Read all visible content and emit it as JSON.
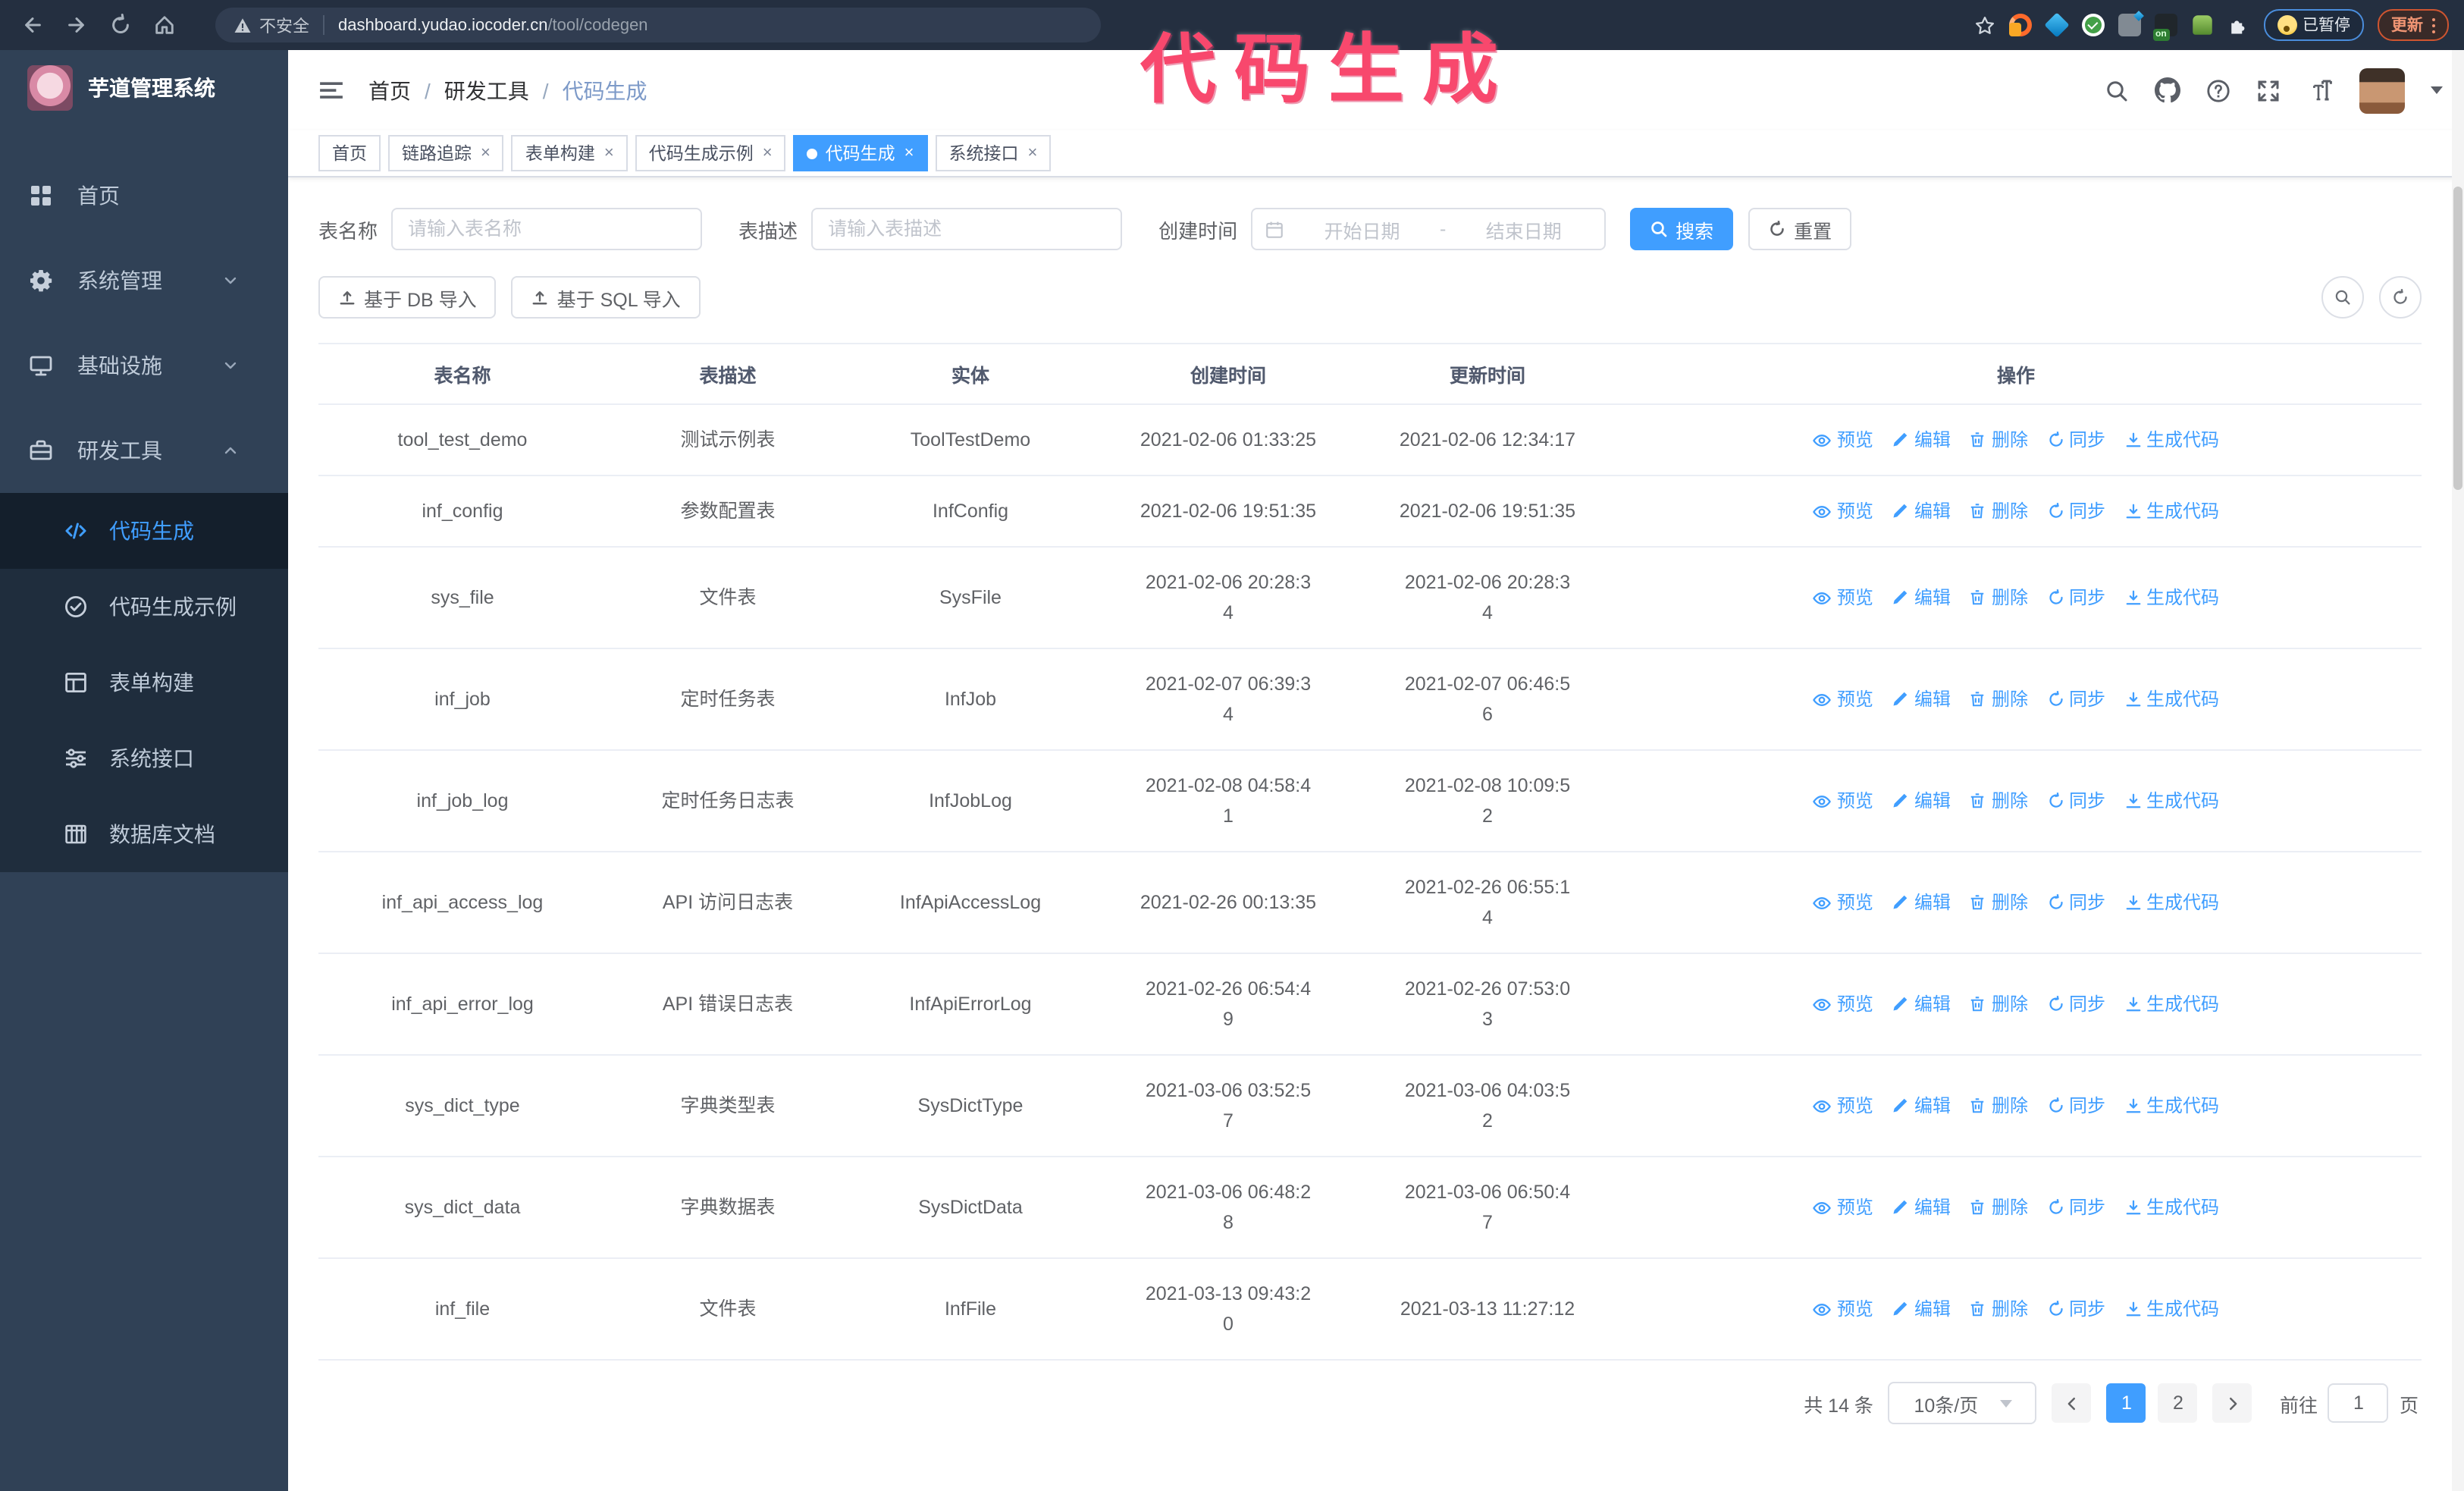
{
  "browser": {
    "insecure_label": "不安全",
    "url_host": "dashboard.yudao.iocoder.cn",
    "url_path": "/tool/codegen",
    "ext_on_label": "on",
    "paused_badge": "已暂停",
    "update_button": "更新",
    "nav_icons": [
      "back-icon",
      "forward-icon",
      "reload-icon",
      "home-icon"
    ],
    "extension_icons": [
      "ext-orange-icon",
      "ext-gem-icon",
      "ext-check-icon",
      "ext-grid-icon",
      "ext-on-icon",
      "ext-green-icon",
      "extensions-puzzle-icon"
    ]
  },
  "annotation": {
    "text": "代码生成",
    "color": "#f8486d"
  },
  "sidebar": {
    "title": "芋道管理系统",
    "items": [
      {
        "label": "首页",
        "icon": "dashboard",
        "chevron": null
      },
      {
        "label": "系统管理",
        "icon": "gear",
        "chevron": "down"
      },
      {
        "label": "基础设施",
        "icon": "monitor",
        "chevron": "down"
      },
      {
        "label": "研发工具",
        "icon": "toolbox",
        "chevron": "up"
      }
    ],
    "sub_items": [
      {
        "label": "代码生成",
        "icon": "code",
        "active": true
      },
      {
        "label": "代码生成示例",
        "icon": "check-circle",
        "active": false
      },
      {
        "label": "表单构建",
        "icon": "form",
        "active": false
      },
      {
        "label": "系统接口",
        "icon": "sliders",
        "active": false
      },
      {
        "label": "数据库文档",
        "icon": "tablecols",
        "active": false
      }
    ]
  },
  "breadcrumb": {
    "items": [
      "首页",
      "研发工具",
      "代码生成"
    ],
    "separator": "/"
  },
  "header_icons": [
    "search",
    "github",
    "question",
    "fullscreen",
    "fontsize"
  ],
  "tabs": [
    {
      "label": "首页",
      "closable": false,
      "active": false
    },
    {
      "label": "链路追踪",
      "closable": true,
      "active": false
    },
    {
      "label": "表单构建",
      "closable": true,
      "active": false
    },
    {
      "label": "代码生成示例",
      "closable": true,
      "active": false
    },
    {
      "label": "代码生成",
      "closable": true,
      "active": true
    },
    {
      "label": "系统接口",
      "closable": true,
      "active": false
    }
  ],
  "search_form": {
    "table_name_label": "表名称",
    "table_name_placeholder": "请输入表名称",
    "table_desc_label": "表描述",
    "table_desc_placeholder": "请输入表描述",
    "create_time_label": "创建时间",
    "start_placeholder": "开始日期",
    "range_separator": "-",
    "end_placeholder": "结束日期",
    "search_label": "搜索",
    "reset_label": "重置"
  },
  "toolbar": {
    "import_db_label": "基于 DB 导入",
    "import_sql_label": "基于 SQL 导入"
  },
  "table": {
    "columns": [
      "表名称",
      "表描述",
      "实体",
      "创建时间",
      "更新时间",
      "操作"
    ],
    "actions": [
      {
        "key": "preview",
        "label": "预览",
        "icon": "eye"
      },
      {
        "key": "edit",
        "label": "编辑",
        "icon": "pen"
      },
      {
        "key": "delete",
        "label": "删除",
        "icon": "trash"
      },
      {
        "key": "sync",
        "label": "同步",
        "icon": "sync"
      },
      {
        "key": "generate",
        "label": "生成代码",
        "icon": "download"
      }
    ],
    "rows": [
      {
        "name": "tool_test_demo",
        "desc": "测试示例表",
        "entity": "ToolTestDemo",
        "created": "2021-02-06 01:33:25",
        "created_wrap": false,
        "updated": "2021-02-06 12:34:17",
        "updated_wrap": false
      },
      {
        "name": "inf_config",
        "desc": "参数配置表",
        "entity": "InfConfig",
        "created": "2021-02-06 19:51:35",
        "created_wrap": false,
        "updated": "2021-02-06 19:51:35",
        "updated_wrap": false
      },
      {
        "name": "sys_file",
        "desc": "文件表",
        "entity": "SysFile",
        "created": "2021-02-06 20:28:34",
        "created_wrap": true,
        "updated": "2021-02-06 20:28:34",
        "updated_wrap": true
      },
      {
        "name": "inf_job",
        "desc": "定时任务表",
        "entity": "InfJob",
        "created": "2021-02-07 06:39:34",
        "created_wrap": true,
        "updated": "2021-02-07 06:46:56",
        "updated_wrap": true
      },
      {
        "name": "inf_job_log",
        "desc": "定时任务日志表",
        "entity": "InfJobLog",
        "created": "2021-02-08 04:58:41",
        "created_wrap": true,
        "updated": "2021-02-08 10:09:52",
        "updated_wrap": true
      },
      {
        "name": "inf_api_access_log",
        "desc": "API 访问日志表",
        "entity": "InfApiAccessLog",
        "created": "2021-02-26 00:13:35",
        "created_wrap": false,
        "updated": "2021-02-26 06:55:14",
        "updated_wrap": true
      },
      {
        "name": "inf_api_error_log",
        "desc": "API 错误日志表",
        "entity": "InfApiErrorLog",
        "created": "2021-02-26 06:54:49",
        "created_wrap": true,
        "updated": "2021-02-26 07:53:03",
        "updated_wrap": true
      },
      {
        "name": "sys_dict_type",
        "desc": "字典类型表",
        "entity": "SysDictType",
        "created": "2021-03-06 03:52:57",
        "created_wrap": true,
        "updated": "2021-03-06 04:03:52",
        "updated_wrap": true
      },
      {
        "name": "sys_dict_data",
        "desc": "字典数据表",
        "entity": "SysDictData",
        "created": "2021-03-06 06:48:28",
        "created_wrap": true,
        "updated": "2021-03-06 06:50:47",
        "updated_wrap": true
      },
      {
        "name": "inf_file",
        "desc": "文件表",
        "entity": "InfFile",
        "created": "2021-03-13 09:43:20",
        "created_wrap": true,
        "updated": "2021-03-13 11:27:12",
        "updated_wrap": false
      }
    ]
  },
  "pagination": {
    "total_text": "共 14 条",
    "page_size": "10条/页",
    "pages": [
      "1",
      "2"
    ],
    "active_page": "1",
    "goto_label": "前往",
    "goto_value": "1",
    "goto_suffix": "页"
  },
  "colors": {
    "accent": "#409eff",
    "sidebar_bg": "#304156",
    "submenu_bg": "#1f2d3d",
    "annotation_pink": "#f8486d"
  }
}
